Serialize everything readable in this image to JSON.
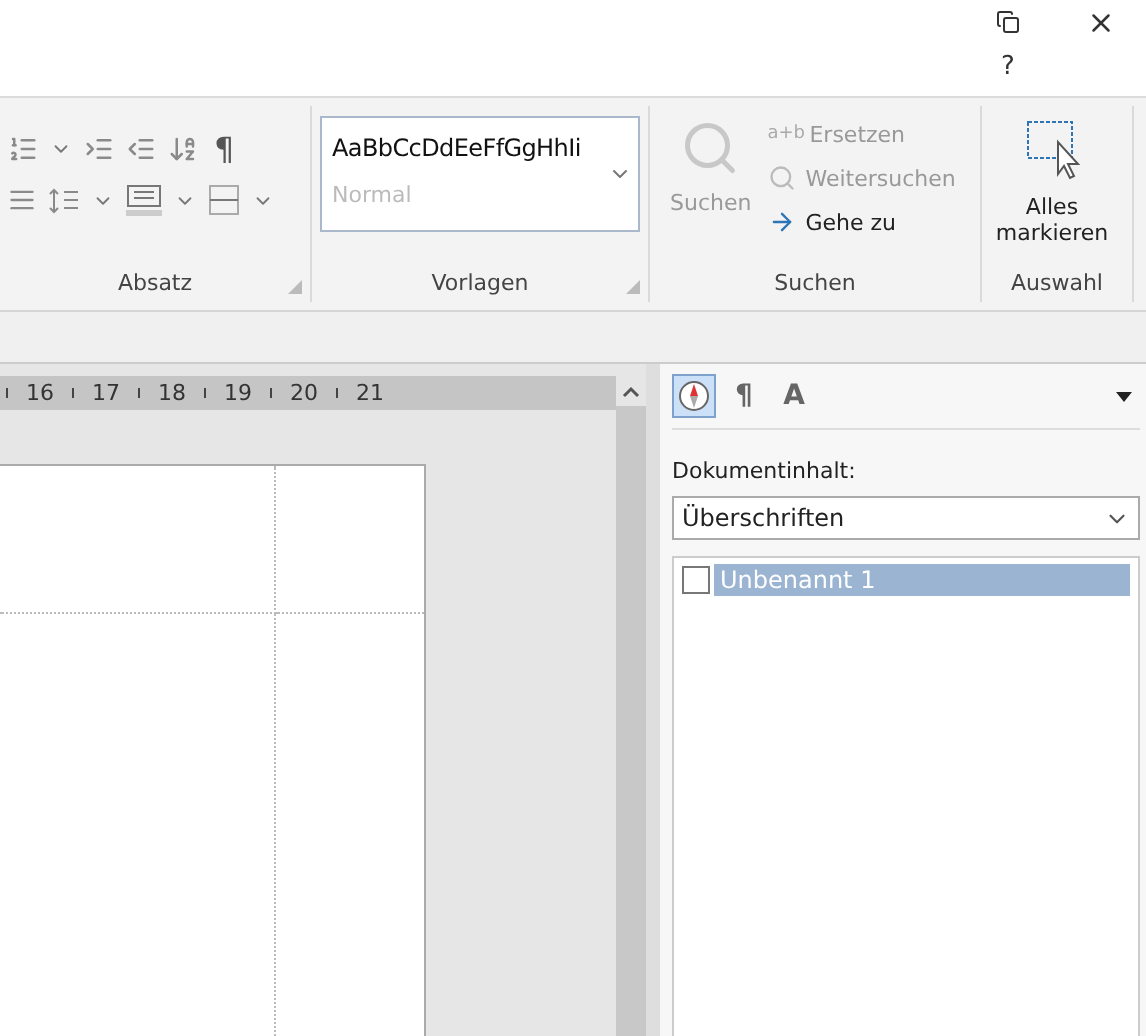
{
  "title_bar": {
    "help": "?"
  },
  "ribbon": {
    "absatz": {
      "label": "Absatz",
      "pilcrow": "¶"
    },
    "vorlagen": {
      "label": "Vorlagen",
      "sample": "AaBbCcDdEeFfGgHhIi",
      "style_name": "Normal"
    },
    "suchen": {
      "label": "Suchen",
      "search_button": {
        "label": "Suchen",
        "disabled": true
      },
      "items": [
        {
          "kind": "replace",
          "icon_text": "a+b",
          "label": "Ersetzen",
          "disabled": true
        },
        {
          "kind": "find_next",
          "label": "Weitersuchen",
          "disabled": true
        },
        {
          "kind": "goto",
          "label": "Gehe zu",
          "disabled": false
        }
      ]
    },
    "auswahl": {
      "label": "Auswahl",
      "button": "Alles markieren"
    }
  },
  "ruler": [
    "16",
    "17",
    "18",
    "19",
    "20",
    "21"
  ],
  "navigator": {
    "tabs": [
      {
        "kind": "navigator",
        "selected": true
      },
      {
        "kind": "glyph",
        "glyph": "¶",
        "selected": false
      },
      {
        "kind": "glyph",
        "glyph": "A",
        "selected": false
      }
    ],
    "label": "Dokumentinhalt:",
    "select": "Überschriften",
    "items": [
      {
        "label": "Unbenannt 1",
        "checked": false,
        "selected": true
      }
    ]
  }
}
